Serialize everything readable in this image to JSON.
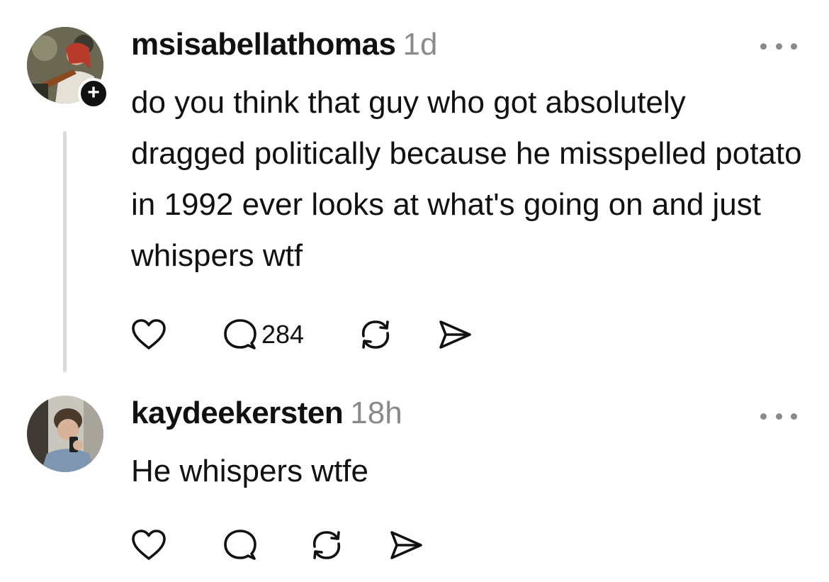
{
  "posts": [
    {
      "username": "msisabellathomas",
      "time": "1d",
      "text": "do you think that guy who got absolutely dragged politically because he misspelled potato in 1992 ever looks at what's going on and just whispers wtf",
      "follow_badge": "+",
      "actions": {
        "like_icon": "heart-icon",
        "reply_icon": "comment-icon",
        "reply_count": "284",
        "repost_icon": "repost-icon",
        "share_icon": "send-icon"
      },
      "more_icon": "more-dots-icon"
    },
    {
      "username": "kaydeekersten",
      "time": "18h",
      "text": "He whispers wtfe",
      "actions": {
        "like_icon": "heart-icon",
        "reply_icon": "comment-icon",
        "repost_icon": "repost-icon",
        "share_icon": "send-icon"
      },
      "more_icon": "more-dots-icon"
    }
  ],
  "colors": {
    "text": "#111111",
    "muted": "#8a8a8a",
    "thread_line": "#d9d9d9"
  }
}
